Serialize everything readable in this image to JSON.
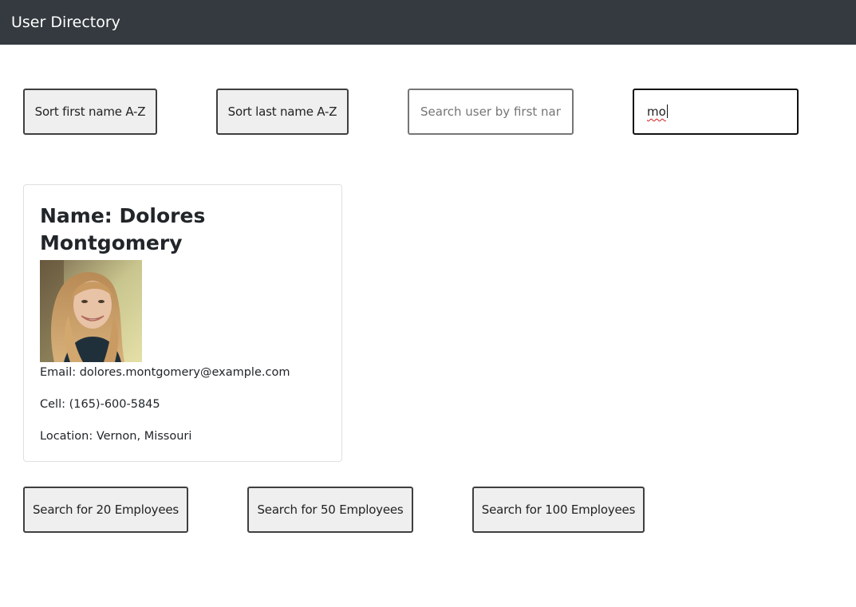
{
  "navbar": {
    "brand": "User Directory"
  },
  "controls": {
    "sort_first_label": "Sort first name A-Z",
    "sort_last_label": "Sort last name A-Z",
    "search_first_placeholder": "Search user by first name",
    "search_first_value": "",
    "search_last_value": "mo"
  },
  "users": [
    {
      "name": "Name: Dolores Montgomery",
      "photo_icon": "user-photo",
      "email": "Email: dolores.montgomery@example.com",
      "cell": "Cell: (165)-600-5845",
      "location": "Location: Vernon, Missouri"
    }
  ],
  "fetch_buttons": {
    "twenty_label": "Search for 20 Employees",
    "fifty_label": "Search for 50 Employees",
    "hundred_label": "Search for 100 Employees"
  },
  "colors": {
    "navbar_bg": "#343a40",
    "button_bg": "#efefef",
    "card_border": "#dfdfdf"
  }
}
